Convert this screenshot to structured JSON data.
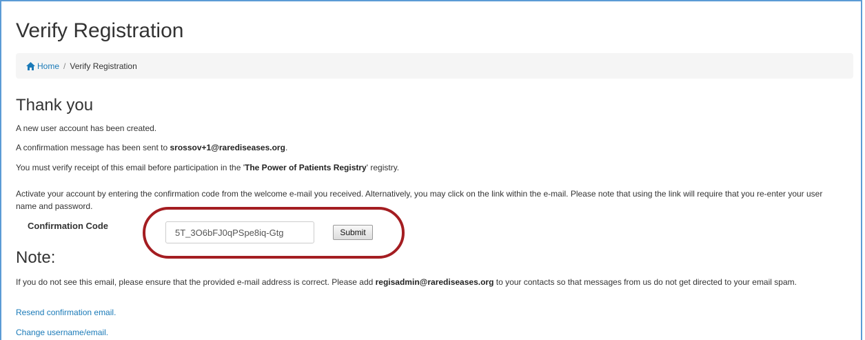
{
  "page": {
    "title": "Verify Registration"
  },
  "breadcrumb": {
    "home_icon": "home-icon",
    "home_label": "Home",
    "separator": "/",
    "current": "Verify Registration"
  },
  "thank_you": {
    "heading": "Thank you",
    "account_created": "A new user account has been created.",
    "sent_prefix": "A confirmation message has been sent to ",
    "email": "srossov+1@rarediseases.org",
    "sent_suffix": ".",
    "verify_prefix": "You must verify receipt of this email before participation in the '",
    "registry_name": "The Power of Patients Registry",
    "verify_suffix": "' registry.",
    "activate_text": "Activate your account by entering the confirmation code from the welcome e-mail you received. Alternatively, you may click on the link within the e-mail. Please note that using the link will require that you re-enter your user name and password."
  },
  "confirmation": {
    "label": "Confirmation Code",
    "code_value": "5T_3O6bFJ0qPSpe8iq-Gtg",
    "submit_label": "Submit"
  },
  "note": {
    "heading": "Note:",
    "text_prefix": "If you do not see this email, please ensure that the provided e-mail address is correct. Please add ",
    "admin_email": "regisadmin@rarediseases.org",
    "text_suffix": " to your contacts so that messages from us do not get directed to your email spam."
  },
  "links": {
    "resend": "Resend confirmation email.",
    "change": "Change username/email."
  },
  "colors": {
    "link": "#1a7ab8",
    "annotation": "#a41d21",
    "frame": "#5b9bd5"
  }
}
